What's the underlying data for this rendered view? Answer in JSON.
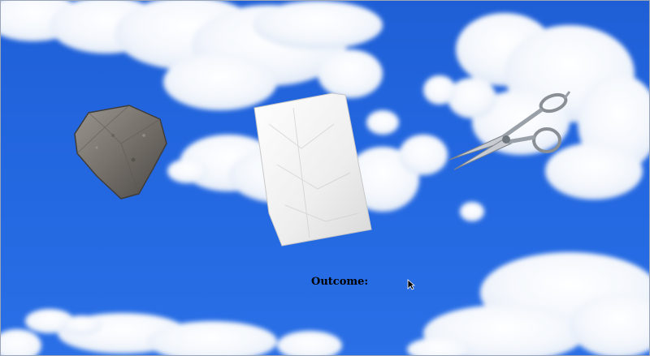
{
  "game": {
    "choices": [
      {
        "id": "rock",
        "icon": "rock-icon"
      },
      {
        "id": "paper",
        "icon": "paper-icon"
      },
      {
        "id": "scissors",
        "icon": "scissors-icon"
      }
    ],
    "outcome_label": "Outcome:",
    "outcome_value": ""
  },
  "colors": {
    "sky_top": "#1f5fd6",
    "sky_bottom": "#2a6fe6",
    "cloud": "#ffffff"
  }
}
